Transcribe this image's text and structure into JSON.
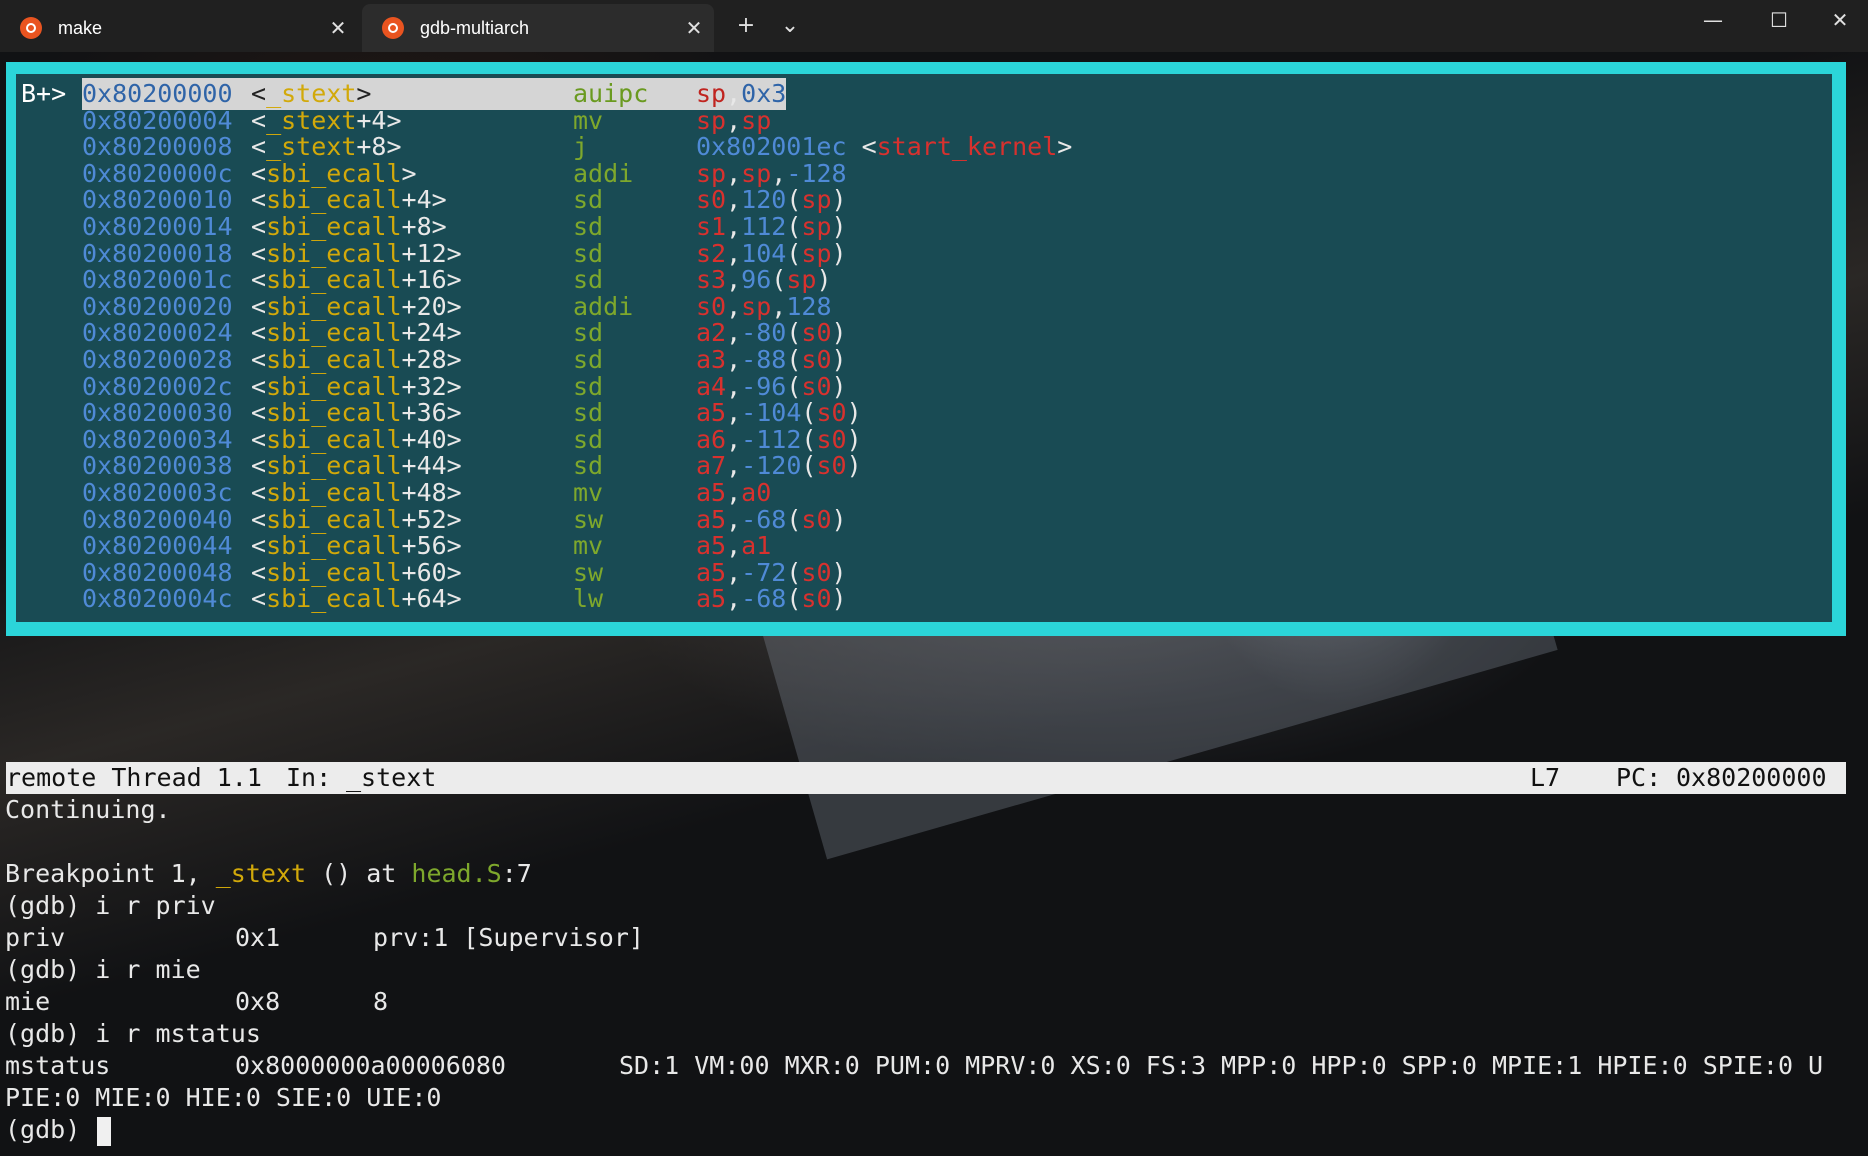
{
  "tabs": [
    {
      "label": "make",
      "active": false
    },
    {
      "label": "gdb-multiarch",
      "active": true
    }
  ],
  "titlebar": {
    "new_tab": "+",
    "dropdown": "⌄",
    "minimize": "—",
    "maximize": "☐",
    "close": "✕",
    "tab_close": "✕"
  },
  "colors": {
    "frame": "#2bd5d9",
    "address": "#4f8ad6",
    "symbol_fn": "#d2a90a",
    "mnemonic": "#7ea82c",
    "register": "#d8312e"
  },
  "asm": {
    "marker": "B+>",
    "rows": [
      {
        "addr": "0x80200000",
        "sym_open": "<",
        "sym_fn": "_stext",
        "sym_rest": ">",
        "mn": "auipc",
        "ops": [
          [
            "r",
            "sp"
          ],
          [
            "t",
            ","
          ],
          [
            "n",
            "0x3"
          ]
        ]
      },
      {
        "addr": "0x80200004",
        "sym_open": "<",
        "sym_fn": "_stext",
        "sym_rest": "+4>",
        "mn": "mv",
        "ops": [
          [
            "r",
            "sp"
          ],
          [
            "t",
            ","
          ],
          [
            "r",
            "sp"
          ]
        ]
      },
      {
        "addr": "0x80200008",
        "sym_open": "<",
        "sym_fn": "_stext",
        "sym_rest": "+8>",
        "mn": "j",
        "ops": [
          [
            "n",
            "0x802001ec"
          ],
          [
            "t",
            " <"
          ],
          [
            "r",
            "start_kernel"
          ],
          [
            "t",
            ">"
          ]
        ]
      },
      {
        "addr": "0x8020000c",
        "sym_open": "<",
        "sym_fn": "sbi_ecall",
        "sym_rest": ">",
        "mn": "addi",
        "ops": [
          [
            "r",
            "sp"
          ],
          [
            "t",
            ","
          ],
          [
            "r",
            "sp"
          ],
          [
            "t",
            ","
          ],
          [
            "n",
            "-128"
          ]
        ]
      },
      {
        "addr": "0x80200010",
        "sym_open": "<",
        "sym_fn": "sbi_ecall",
        "sym_rest": "+4>",
        "mn": "sd",
        "ops": [
          [
            "r",
            "s0"
          ],
          [
            "t",
            ","
          ],
          [
            "n",
            "120"
          ],
          [
            "t",
            "("
          ],
          [
            "r",
            "sp"
          ],
          [
            "t",
            ")"
          ]
        ]
      },
      {
        "addr": "0x80200014",
        "sym_open": "<",
        "sym_fn": "sbi_ecall",
        "sym_rest": "+8>",
        "mn": "sd",
        "ops": [
          [
            "r",
            "s1"
          ],
          [
            "t",
            ","
          ],
          [
            "n",
            "112"
          ],
          [
            "t",
            "("
          ],
          [
            "r",
            "sp"
          ],
          [
            "t",
            ")"
          ]
        ]
      },
      {
        "addr": "0x80200018",
        "sym_open": "<",
        "sym_fn": "sbi_ecall",
        "sym_rest": "+12>",
        "mn": "sd",
        "ops": [
          [
            "r",
            "s2"
          ],
          [
            "t",
            ","
          ],
          [
            "n",
            "104"
          ],
          [
            "t",
            "("
          ],
          [
            "r",
            "sp"
          ],
          [
            "t",
            ")"
          ]
        ]
      },
      {
        "addr": "0x8020001c",
        "sym_open": "<",
        "sym_fn": "sbi_ecall",
        "sym_rest": "+16>",
        "mn": "sd",
        "ops": [
          [
            "r",
            "s3"
          ],
          [
            "t",
            ","
          ],
          [
            "n",
            "96"
          ],
          [
            "t",
            "("
          ],
          [
            "r",
            "sp"
          ],
          [
            "t",
            ")"
          ]
        ]
      },
      {
        "addr": "0x80200020",
        "sym_open": "<",
        "sym_fn": "sbi_ecall",
        "sym_rest": "+20>",
        "mn": "addi",
        "ops": [
          [
            "r",
            "s0"
          ],
          [
            "t",
            ","
          ],
          [
            "r",
            "sp"
          ],
          [
            "t",
            ","
          ],
          [
            "n",
            "128"
          ]
        ]
      },
      {
        "addr": "0x80200024",
        "sym_open": "<",
        "sym_fn": "sbi_ecall",
        "sym_rest": "+24>",
        "mn": "sd",
        "ops": [
          [
            "r",
            "a2"
          ],
          [
            "t",
            ","
          ],
          [
            "n",
            "-80"
          ],
          [
            "t",
            "("
          ],
          [
            "r",
            "s0"
          ],
          [
            "t",
            ")"
          ]
        ]
      },
      {
        "addr": "0x80200028",
        "sym_open": "<",
        "sym_fn": "sbi_ecall",
        "sym_rest": "+28>",
        "mn": "sd",
        "ops": [
          [
            "r",
            "a3"
          ],
          [
            "t",
            ","
          ],
          [
            "n",
            "-88"
          ],
          [
            "t",
            "("
          ],
          [
            "r",
            "s0"
          ],
          [
            "t",
            ")"
          ]
        ]
      },
      {
        "addr": "0x8020002c",
        "sym_open": "<",
        "sym_fn": "sbi_ecall",
        "sym_rest": "+32>",
        "mn": "sd",
        "ops": [
          [
            "r",
            "a4"
          ],
          [
            "t",
            ","
          ],
          [
            "n",
            "-96"
          ],
          [
            "t",
            "("
          ],
          [
            "r",
            "s0"
          ],
          [
            "t",
            ")"
          ]
        ]
      },
      {
        "addr": "0x80200030",
        "sym_open": "<",
        "sym_fn": "sbi_ecall",
        "sym_rest": "+36>",
        "mn": "sd",
        "ops": [
          [
            "r",
            "a5"
          ],
          [
            "t",
            ","
          ],
          [
            "n",
            "-104"
          ],
          [
            "t",
            "("
          ],
          [
            "r",
            "s0"
          ],
          [
            "t",
            ")"
          ]
        ]
      },
      {
        "addr": "0x80200034",
        "sym_open": "<",
        "sym_fn": "sbi_ecall",
        "sym_rest": "+40>",
        "mn": "sd",
        "ops": [
          [
            "r",
            "a6"
          ],
          [
            "t",
            ","
          ],
          [
            "n",
            "-112"
          ],
          [
            "t",
            "("
          ],
          [
            "r",
            "s0"
          ],
          [
            "t",
            ")"
          ]
        ]
      },
      {
        "addr": "0x80200038",
        "sym_open": "<",
        "sym_fn": "sbi_ecall",
        "sym_rest": "+44>",
        "mn": "sd",
        "ops": [
          [
            "r",
            "a7"
          ],
          [
            "t",
            ","
          ],
          [
            "n",
            "-120"
          ],
          [
            "t",
            "("
          ],
          [
            "r",
            "s0"
          ],
          [
            "t",
            ")"
          ]
        ]
      },
      {
        "addr": "0x8020003c",
        "sym_open": "<",
        "sym_fn": "sbi_ecall",
        "sym_rest": "+48>",
        "mn": "mv",
        "ops": [
          [
            "r",
            "a5"
          ],
          [
            "t",
            ","
          ],
          [
            "r",
            "a0"
          ]
        ]
      },
      {
        "addr": "0x80200040",
        "sym_open": "<",
        "sym_fn": "sbi_ecall",
        "sym_rest": "+52>",
        "mn": "sw",
        "ops": [
          [
            "r",
            "a5"
          ],
          [
            "t",
            ","
          ],
          [
            "n",
            "-68"
          ],
          [
            "t",
            "("
          ],
          [
            "r",
            "s0"
          ],
          [
            "t",
            ")"
          ]
        ]
      },
      {
        "addr": "0x80200044",
        "sym_open": "<",
        "sym_fn": "sbi_ecall",
        "sym_rest": "+56>",
        "mn": "mv",
        "ops": [
          [
            "r",
            "a5"
          ],
          [
            "t",
            ","
          ],
          [
            "r",
            "a1"
          ]
        ]
      },
      {
        "addr": "0x80200048",
        "sym_open": "<",
        "sym_fn": "sbi_ecall",
        "sym_rest": "+60>",
        "mn": "sw",
        "ops": [
          [
            "r",
            "a5"
          ],
          [
            "t",
            ","
          ],
          [
            "n",
            "-72"
          ],
          [
            "t",
            "("
          ],
          [
            "r",
            "s0"
          ],
          [
            "t",
            ")"
          ]
        ]
      },
      {
        "addr": "0x8020004c",
        "sym_open": "<",
        "sym_fn": "sbi_ecall",
        "sym_rest": "+64>",
        "mn": "lw",
        "ops": [
          [
            "r",
            "a5"
          ],
          [
            "t",
            ","
          ],
          [
            "n",
            "-68"
          ],
          [
            "t",
            "("
          ],
          [
            "r",
            "s0"
          ],
          [
            "t",
            ")"
          ]
        ]
      }
    ]
  },
  "status": {
    "thread": "remote Thread 1.1",
    "in_label": "In:",
    "in_func": "_stext",
    "line": "L7",
    "pc_label": "PC:",
    "pc_value": "0x80200000"
  },
  "console": {
    "l0": "Continuing.",
    "l1_pre": "Breakpoint 1, ",
    "l1_fn": "_stext",
    "l1_mid": " () at ",
    "l1_file": "head.S",
    "l1_post": ":7",
    "l2": "(gdb) i r priv",
    "l3_name": "priv",
    "l3_val": "0x1",
    "l3_info": "prv:1 [Supervisor]",
    "l4": "(gdb) i r mie",
    "l5_name": "mie",
    "l5_val": "0x8",
    "l5_info": "8",
    "l6": "(gdb) i r mstatus",
    "l7_name": "mstatus",
    "l7_val": "0x8000000a00006080",
    "l7_info": "SD:1 VM:00 MXR:0 PUM:0 MPRV:0 XS:0 FS:3 MPP:0 HPP:0 SPP:0 MPIE:1 HPIE:0 SPIE:0 U",
    "l8": "PIE:0 MIE:0 HIE:0 SIE:0 UIE:0",
    "prompt": "(gdb) "
  }
}
